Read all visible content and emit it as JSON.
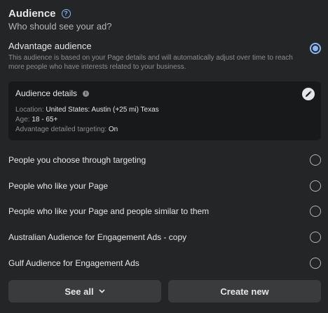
{
  "header": {
    "title": "Audience",
    "subtitle": "Who should see your ad?"
  },
  "advantage": {
    "title": "Advantage audience",
    "description": "This audience is based on your Page details and will automatically adjust over time to reach more people who have interests related to your business.",
    "selected": true
  },
  "details": {
    "title": "Audience details",
    "location_label": "Location:",
    "location_value": "United States: Austin (+25 mi) Texas",
    "age_label": "Age:",
    "age_value": "18 - 65+",
    "targeting_label": "Advantage detailed targeting:",
    "targeting_value": "On"
  },
  "options": [
    {
      "label": "People you choose through targeting",
      "selected": false
    },
    {
      "label": "People who like your Page",
      "selected": false
    },
    {
      "label": "People who like your Page and people similar to them",
      "selected": false
    },
    {
      "label": "Australian Audience for Engagement Ads - copy",
      "selected": false
    },
    {
      "label": "Gulf Audience for Engagement Ads",
      "selected": false
    }
  ],
  "buttons": {
    "see_all": "See all",
    "create_new": "Create new"
  },
  "colors": {
    "background": "#242526",
    "card": "#18191a",
    "accent": "#8ab4f8",
    "button": "#3a3b3c"
  }
}
